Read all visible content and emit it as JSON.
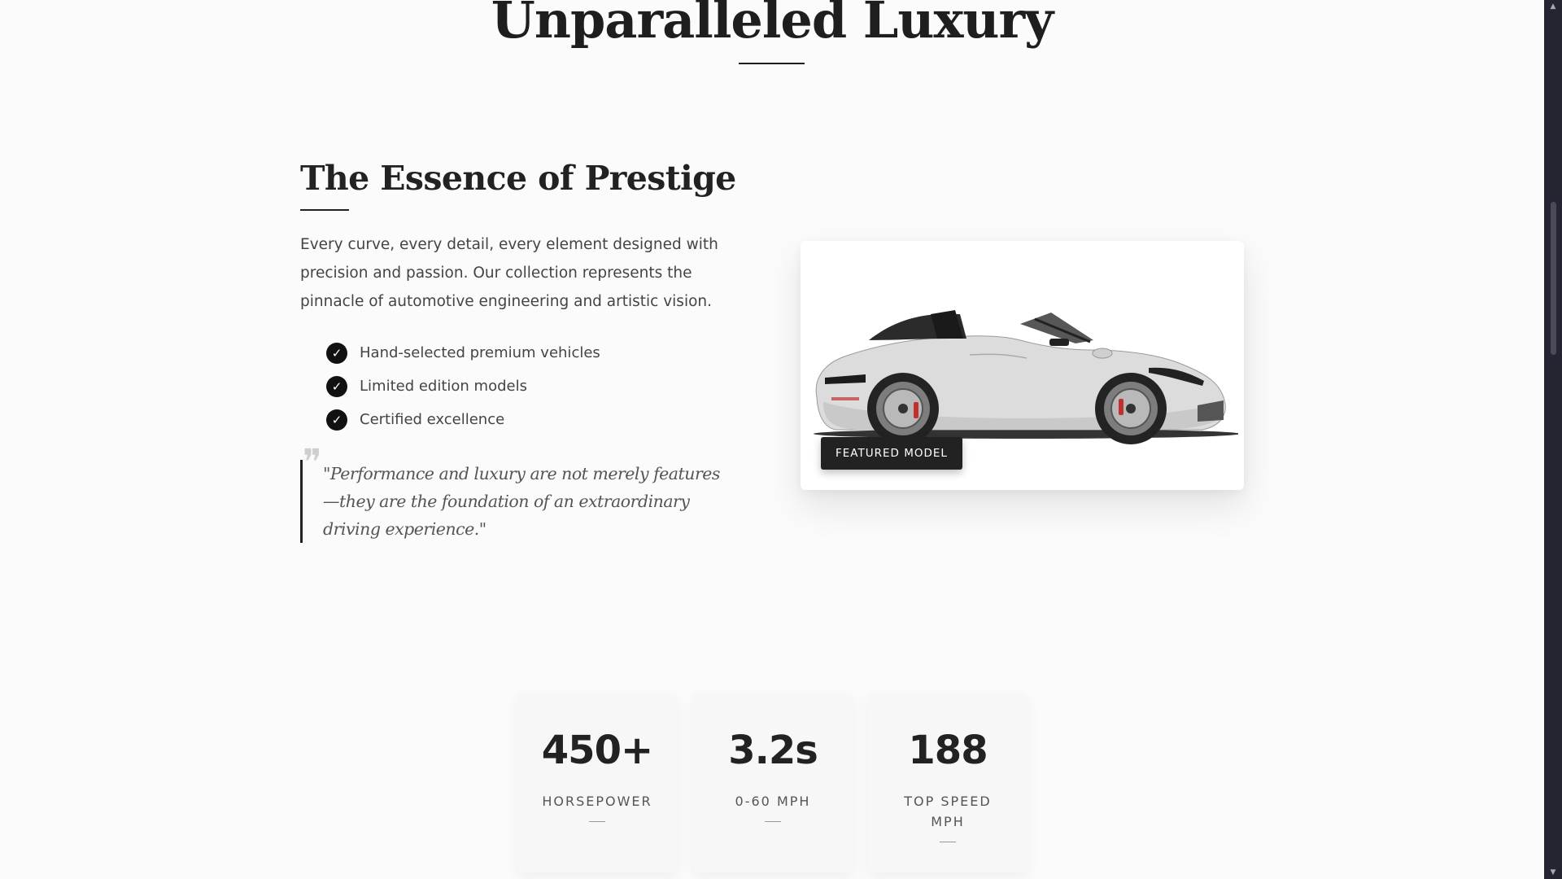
{
  "section": {
    "title": "Unparalleled Luxury"
  },
  "essence": {
    "title": "The Essence of Prestige",
    "intro": "Every curve, every detail, every element designed with precision and passion. Our collection represents the pinnacle of automotive engineering and artistic vision.",
    "features": [
      {
        "icon": "check-icon",
        "label": "Hand-selected premium vehicles"
      },
      {
        "icon": "check-icon",
        "label": "Limited edition models"
      },
      {
        "icon": "check-icon",
        "label": "Certified excellence"
      }
    ],
    "quote": "\"Performance and luxury are not merely features—they are the foundation of an extraordinary driving experience.\""
  },
  "featured": {
    "badge": "FEATURED MODEL",
    "image": "white-convertible-sports-car"
  },
  "stats": [
    {
      "value": "450+",
      "label": "HORSEPOWER"
    },
    {
      "value": "3.2s",
      "label": "0-60 MPH"
    },
    {
      "value": "188",
      "label": "TOP SPEED MPH"
    }
  ],
  "colors": {
    "accent": "#222222",
    "background": "#fbfbfb",
    "scrollbar": "#252532"
  }
}
